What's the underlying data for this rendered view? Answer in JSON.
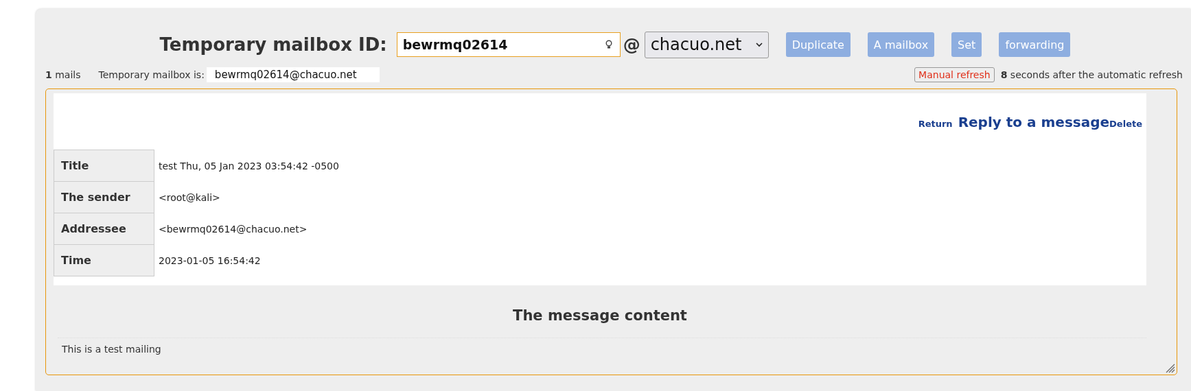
{
  "header": {
    "label": "Temporary mailbox ID:",
    "mailbox_id": "bewrmq02614",
    "at": "@",
    "domain": "chacuo.net",
    "buttons": [
      "Duplicate",
      "A mailbox",
      "Set",
      "forwarding"
    ]
  },
  "status": {
    "count": "1",
    "count_label": "mails",
    "address_label": "Temporary mailbox is:",
    "address": "bewrmq02614@chacuo.net",
    "refresh_button": "Manual refresh",
    "seconds": "8",
    "seconds_label": "seconds after the automatic refresh"
  },
  "message": {
    "actions": [
      {
        "label": "Return",
        "kind": "small"
      },
      {
        "label": "Reply to a message",
        "kind": "large"
      },
      {
        "label": "Delete",
        "kind": "small"
      }
    ],
    "fields": [
      {
        "label": "Title",
        "value": "test Thu, 05 Jan 2023 03:54:42 -0500"
      },
      {
        "label": "The sender",
        "value": "<root@kali>"
      },
      {
        "label": "Addressee",
        "value": "<bewrmq02614@chacuo.net>"
      },
      {
        "label": "Time",
        "value": "2023-01-05 16:54:42"
      }
    ],
    "content_heading": "The message content",
    "body": "This is a test mailing"
  }
}
